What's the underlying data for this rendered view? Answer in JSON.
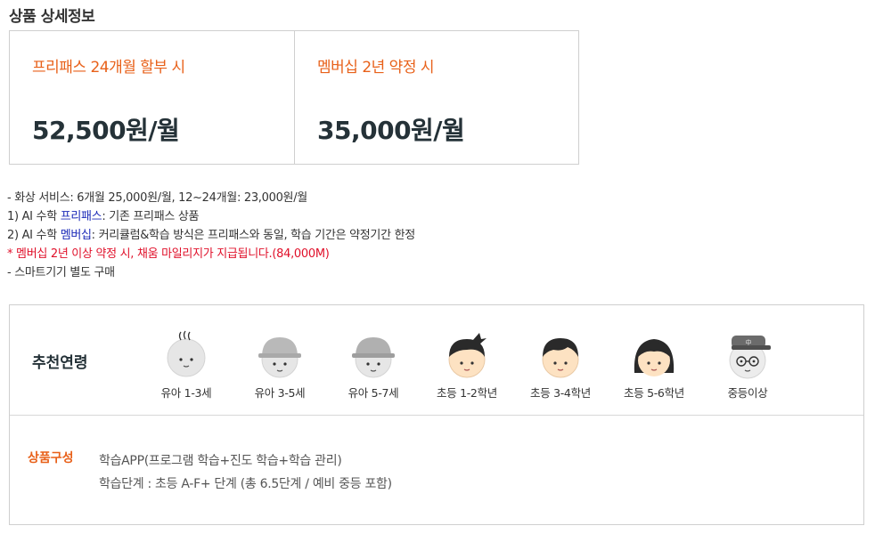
{
  "section_title": "상품 상세정보",
  "prices": [
    {
      "label": "프리패스 24개월 할부 시",
      "value": "52,500원/월"
    },
    {
      "label": "멤버십 2년 약정 시",
      "value": "35,000원/월"
    }
  ],
  "notes": {
    "line1": "- 화상 서비스: 6개월 25,000원/월, 12~24개월: 23,000원/월",
    "line2_prefix": "1) AI 수학 ",
    "line2_link": "프리패스",
    "line2_suffix": ": 기존 프리패스 상품",
    "line3_prefix": "2) AI 수학 ",
    "line3_link": "멤버십",
    "line3_suffix": ": 커리큘럼&학습 방식은 프리패스와 동일, 학습 기간은 약정기간 한정",
    "line4": "* 멤버십 2년 이상 약정 시, 채움 마일리지가 지급됩니다.(84,000M)",
    "line5": "- 스마트기기 별도 구매"
  },
  "age": {
    "title": "추천연령",
    "items": [
      {
        "label": "유아 1-3세",
        "icon": "baby-face-icon"
      },
      {
        "label": "유아 3-5세",
        "icon": "kid-hat-face-icon"
      },
      {
        "label": "유아 5-7세",
        "icon": "kid-hat-face-icon"
      },
      {
        "label": "초등 1-2학년",
        "icon": "elementary-boy-face-icon"
      },
      {
        "label": "초등 3-4학년",
        "icon": "elementary-boy-face-icon"
      },
      {
        "label": "초등 5-6학년",
        "icon": "elementary-girl-face-icon"
      },
      {
        "label": "중등이상",
        "icon": "middle-school-student-face-icon"
      }
    ]
  },
  "composition": {
    "title": "상품구성",
    "line1": "학습APP(프로그램 학습+진도 학습+학습 관리)",
    "line2": "학습단계 : 초등 A-F+ 단계 (총 6.5단계 / 예비 중등 포함)"
  },
  "colors": {
    "accent": "#e8611a",
    "link": "#1c2bb8",
    "warning": "#e0102a",
    "price": "#253238"
  }
}
